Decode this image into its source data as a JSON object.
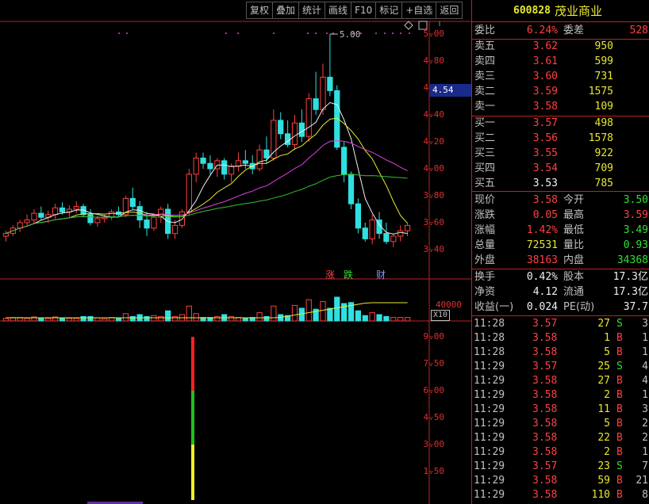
{
  "toolbar": {
    "buttons": [
      "复权",
      "叠加",
      "统计",
      "画线",
      "F10",
      "标记",
      "+自选",
      "返回"
    ]
  },
  "stock": {
    "code": "600828",
    "name": "茂业商业"
  },
  "colors": {
    "up": "#ff4040",
    "down": "#30e0e0",
    "ma5": "#f0f0f0",
    "ma10": "#e8e830",
    "ma20": "#e040e0",
    "ma60": "#30c030",
    "border": "#c02020"
  },
  "price_axis": {
    "labels": [
      "5.00",
      "4.80",
      "4.60",
      "4.40",
      "4.20",
      "4.00",
      "3.80",
      "3.60",
      "3.40"
    ],
    "current_marker": "4.54",
    "high_marker": "5.00"
  },
  "volume_axis": {
    "label": "40000",
    "unit": "X10"
  },
  "indicator_axis": {
    "labels": [
      "9.00",
      "7.50",
      "6.00",
      "4.50",
      "3.00",
      "1.50"
    ]
  },
  "event_tags": [
    {
      "text": "涨",
      "color": "#ff4040"
    },
    {
      "text": "跌",
      "color": "#30e030"
    },
    {
      "text": "财",
      "color": "#9090ff"
    }
  ],
  "chart_data": {
    "type": "candlestick",
    "ylim": [
      3.35,
      5.05
    ],
    "candles": [
      [
        3.5,
        3.54,
        3.46,
        3.52
      ],
      [
        3.52,
        3.58,
        3.5,
        3.56
      ],
      [
        3.56,
        3.62,
        3.53,
        3.6
      ],
      [
        3.6,
        3.66,
        3.57,
        3.62
      ],
      [
        3.62,
        3.7,
        3.59,
        3.67
      ],
      [
        3.67,
        3.72,
        3.62,
        3.64
      ],
      [
        3.64,
        3.69,
        3.6,
        3.66
      ],
      [
        3.66,
        3.74,
        3.63,
        3.71
      ],
      [
        3.71,
        3.75,
        3.66,
        3.68
      ],
      [
        3.68,
        3.73,
        3.64,
        3.7
      ],
      [
        3.7,
        3.76,
        3.67,
        3.72
      ],
      [
        3.72,
        3.74,
        3.64,
        3.66
      ],
      [
        3.66,
        3.7,
        3.58,
        3.6
      ],
      [
        3.6,
        3.65,
        3.57,
        3.63
      ],
      [
        3.63,
        3.66,
        3.6,
        3.64
      ],
      [
        3.64,
        3.7,
        3.62,
        3.68
      ],
      [
        3.68,
        3.72,
        3.64,
        3.66
      ],
      [
        3.66,
        3.8,
        3.64,
        3.78
      ],
      [
        3.78,
        3.86,
        3.7,
        3.72
      ],
      [
        3.72,
        3.76,
        3.56,
        3.62
      ],
      [
        3.62,
        3.68,
        3.5,
        3.56
      ],
      [
        3.56,
        3.66,
        3.54,
        3.64
      ],
      [
        3.64,
        3.72,
        3.6,
        3.7
      ],
      [
        3.7,
        3.74,
        3.48,
        3.52
      ],
      [
        3.52,
        3.62,
        3.48,
        3.58
      ],
      [
        3.58,
        3.7,
        3.56,
        3.68
      ],
      [
        3.68,
        4.0,
        3.66,
        3.96
      ],
      [
        3.96,
        4.12,
        3.9,
        4.08
      ],
      [
        4.08,
        4.12,
        4.0,
        4.04
      ],
      [
        4.04,
        4.1,
        3.96,
        4.0
      ],
      [
        4.0,
        4.08,
        3.94,
        4.06
      ],
      [
        4.06,
        4.08,
        3.92,
        3.96
      ],
      [
        3.96,
        4.04,
        3.9,
        4.02
      ],
      [
        4.02,
        4.12,
        3.98,
        4.06
      ],
      [
        4.06,
        4.14,
        4.0,
        4.04
      ],
      [
        4.04,
        4.1,
        3.96,
        4.0
      ],
      [
        4.0,
        4.18,
        3.98,
        4.14
      ],
      [
        4.14,
        4.24,
        4.04,
        4.08
      ],
      [
        4.08,
        4.44,
        4.06,
        4.36
      ],
      [
        4.36,
        4.42,
        4.22,
        4.26
      ],
      [
        4.26,
        4.36,
        4.16,
        4.18
      ],
      [
        4.18,
        4.4,
        4.14,
        4.34
      ],
      [
        4.34,
        4.44,
        4.2,
        4.24
      ],
      [
        4.24,
        4.56,
        4.2,
        4.52
      ],
      [
        4.52,
        4.72,
        4.4,
        4.44
      ],
      [
        4.44,
        4.78,
        4.4,
        4.68
      ],
      [
        4.68,
        5.0,
        4.54,
        4.58
      ],
      [
        4.58,
        4.62,
        4.14,
        4.16
      ],
      [
        4.16,
        4.2,
        3.9,
        3.96
      ],
      [
        3.96,
        3.98,
        3.7,
        3.74
      ],
      [
        3.74,
        3.78,
        3.52,
        3.56
      ],
      [
        3.56,
        3.6,
        3.46,
        3.48
      ],
      [
        3.48,
        3.66,
        3.44,
        3.62
      ],
      [
        3.62,
        3.68,
        3.48,
        3.52
      ],
      [
        3.52,
        3.6,
        3.44,
        3.46
      ],
      [
        3.46,
        3.52,
        3.42,
        3.5
      ],
      [
        3.5,
        3.58,
        3.46,
        3.54
      ],
      [
        3.54,
        3.6,
        3.5,
        3.58
      ]
    ]
  },
  "quote": {
    "weibi_label": "委比",
    "weibi": "6.24%",
    "weicha_label": "委差",
    "weicha": "528",
    "asks": [
      {
        "label": "卖五",
        "price": "3.62",
        "vol": "950"
      },
      {
        "label": "卖四",
        "price": "3.61",
        "vol": "599"
      },
      {
        "label": "卖三",
        "price": "3.60",
        "vol": "731"
      },
      {
        "label": "卖二",
        "price": "3.59",
        "vol": "1575"
      },
      {
        "label": "卖一",
        "price": "3.58",
        "vol": "109"
      }
    ],
    "bids": [
      {
        "label": "买一",
        "price": "3.57",
        "vol": "498",
        "cls": "red"
      },
      {
        "label": "买二",
        "price": "3.56",
        "vol": "1578",
        "cls": "red"
      },
      {
        "label": "买三",
        "price": "3.55",
        "vol": "922",
        "cls": "red"
      },
      {
        "label": "买四",
        "price": "3.54",
        "vol": "709",
        "cls": "red"
      },
      {
        "label": "买五",
        "price": "3.53",
        "vol": "785",
        "cls": "white"
      }
    ],
    "stats1": [
      {
        "l1": "现价",
        "v1": "3.58",
        "c1": "red",
        "l2": "今开",
        "v2": "3.50",
        "c2": "green"
      },
      {
        "l1": "涨跌",
        "v1": "0.05",
        "c1": "red",
        "l2": "最高",
        "v2": "3.59",
        "c2": "red"
      },
      {
        "l1": "涨幅",
        "v1": "1.42%",
        "c1": "red",
        "l2": "最低",
        "v2": "3.49",
        "c2": "green"
      },
      {
        "l1": "总量",
        "v1": "72531",
        "c1": "yellow",
        "l2": "量比",
        "v2": "0.93",
        "c2": "green"
      },
      {
        "l1": "外盘",
        "v1": "38163",
        "c1": "red",
        "l2": "内盘",
        "v2": "34368",
        "c2": "green"
      }
    ],
    "stats2": [
      {
        "l1": "换手",
        "v1": "0.42%",
        "l2": "股本",
        "v2": "17.3亿"
      },
      {
        "l1": "净资",
        "v1": "4.12",
        "l2": "流通",
        "v2": "17.3亿"
      },
      {
        "l1": "收益(一)",
        "v1": "0.024",
        "l2": "PE(动)",
        "v2": "37.7"
      }
    ]
  },
  "ticks": [
    {
      "time": "11:28",
      "price": "3.57",
      "vol": "27",
      "side": "S",
      "count": "3"
    },
    {
      "time": "11:28",
      "price": "3.58",
      "vol": "1",
      "side": "B",
      "count": "1"
    },
    {
      "time": "11:28",
      "price": "3.58",
      "vol": "5",
      "side": "B",
      "count": "1"
    },
    {
      "time": "11:29",
      "price": "3.57",
      "vol": "25",
      "side": "S",
      "count": "4"
    },
    {
      "time": "11:29",
      "price": "3.58",
      "vol": "27",
      "side": "B",
      "count": "4"
    },
    {
      "time": "11:29",
      "price": "3.58",
      "vol": "2",
      "side": "B",
      "count": "1"
    },
    {
      "time": "11:29",
      "price": "3.58",
      "vol": "11",
      "side": "B",
      "count": "3"
    },
    {
      "time": "11:29",
      "price": "3.58",
      "vol": "5",
      "side": "B",
      "count": "2"
    },
    {
      "time": "11:29",
      "price": "3.58",
      "vol": "22",
      "side": "B",
      "count": "2"
    },
    {
      "time": "11:29",
      "price": "3.58",
      "vol": "2",
      "side": "B",
      "count": "1"
    },
    {
      "time": "11:29",
      "price": "3.57",
      "vol": "23",
      "side": "S",
      "count": "7"
    },
    {
      "time": "11:29",
      "price": "3.58",
      "vol": "59",
      "side": "B",
      "count": "21"
    },
    {
      "time": "11:29",
      "price": "3.58",
      "vol": "110",
      "side": "B",
      "count": "8"
    }
  ]
}
